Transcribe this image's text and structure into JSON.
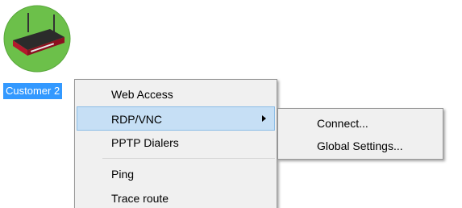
{
  "desktop": {
    "device_label": "Customer 2",
    "device_icon": "router-icon",
    "selection_color": "#3399ff"
  },
  "context_menu": {
    "items": [
      {
        "label": "Web Access",
        "highlighted": false,
        "has_submenu": false
      },
      {
        "label": "RDP/VNC",
        "highlighted": true,
        "has_submenu": true
      },
      {
        "label": "PPTP Dialers",
        "highlighted": false,
        "has_submenu": false
      },
      {
        "label": "Ping",
        "highlighted": false,
        "has_submenu": false
      },
      {
        "label": "Trace route",
        "highlighted": false,
        "has_submenu": false
      }
    ],
    "highlight_color": "#c6dff5"
  },
  "sub_menu": {
    "items": [
      {
        "label": "Connect..."
      },
      {
        "label": "Global Settings..."
      }
    ]
  }
}
